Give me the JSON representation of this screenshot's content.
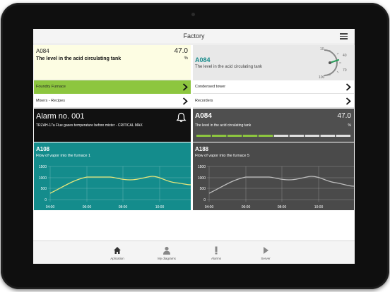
{
  "header": {
    "title": "Factory"
  },
  "tile_a084_yellow": {
    "code": "A084",
    "value": "47.0",
    "unit": "%",
    "description": "The level in the acid circulating tank"
  },
  "tile_a084_gauge": {
    "code": "A084",
    "description": "The level in the acid circulating tank",
    "gauge_ticks": [
      "10",
      "40",
      "70",
      "100"
    ]
  },
  "nav": {
    "foundry": "Foundry Furnace",
    "condensed": "Condensed tower",
    "mixers": "Mixers - Recipes",
    "recorders": "Recorders"
  },
  "alarm": {
    "title": "Alarm no. 001",
    "description": "TRZAH-17a Flue gases temperature before mister - CRITICAL MAX"
  },
  "tile_a084_dark": {
    "code": "A084",
    "value": "47.0",
    "unit": "%",
    "description": "The level in the acid circulating tank",
    "level_fraction": 0.47
  },
  "charts": [
    {
      "code": "A108",
      "description": "Flow of vapor into the furnace 1",
      "y_ticks": [
        "1500",
        "1000",
        "500",
        "0"
      ],
      "x_ticks": [
        "04:00",
        "06:00",
        "08:00",
        "10:00"
      ]
    },
    {
      "code": "A188",
      "description": "Flow of vapor into the furnace 5",
      "y_ticks": [
        "1500",
        "1000",
        "500",
        "0"
      ],
      "x_ticks": [
        "04:00",
        "06:00",
        "08:00",
        "10:00"
      ]
    }
  ],
  "tabs": [
    {
      "label": "Aplication",
      "icon": "home-icon"
    },
    {
      "label": "My diagrams",
      "icon": "person-icon"
    },
    {
      "label": "Alarms",
      "icon": "exclamation-icon"
    },
    {
      "label": "Server",
      "icon": "play-icon"
    }
  ],
  "colors": {
    "green": "#8dc63f",
    "teal": "#148c8c",
    "dark": "#111111",
    "gray": "#4f4f4f",
    "chart_line_1": "#e6e67a",
    "chart_line_2": "#bdbdbd",
    "gauge_needle": "#2a9d5a"
  }
}
